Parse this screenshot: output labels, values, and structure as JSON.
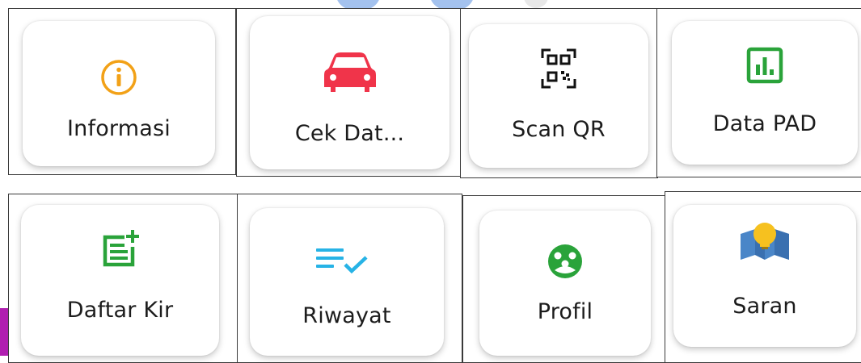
{
  "menu": {
    "row1": [
      {
        "label": "Informasi",
        "icon": "info-icon",
        "color": "#f2a117"
      },
      {
        "label": "Cek Dat...",
        "icon": "car-icon",
        "color": "#f0344a"
      },
      {
        "label": "Scan QR",
        "icon": "qr-scan-icon",
        "color": "#111111"
      },
      {
        "label": "Data PAD",
        "icon": "bar-chart-icon",
        "color": "#2aa33a"
      }
    ],
    "row2": [
      {
        "label": "Daftar Kir",
        "icon": "note-add-icon",
        "color": "#2aa33a"
      },
      {
        "label": "Riwayat",
        "icon": "checklist-icon",
        "color": "#27b3e6"
      },
      {
        "label": "Profil",
        "icon": "profile-icon",
        "color": "#2aa33a"
      },
      {
        "label": "Saran",
        "icon": "idea-map-icon",
        "color": "#f6c11f"
      }
    ]
  }
}
